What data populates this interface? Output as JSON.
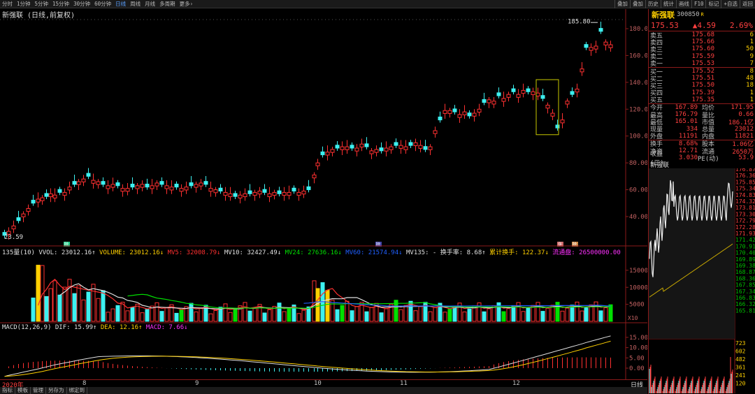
{
  "toolbar": {
    "timeframes": [
      "分时",
      "1分钟",
      "5分钟",
      "15分钟",
      "30分钟",
      "60分钟",
      "日线",
      "周线",
      "月线",
      "多周期",
      "更多›"
    ],
    "active_timeframe": "日线",
    "right_buttons": [
      "叠加",
      "叠加",
      "历史",
      "统计",
      "画线",
      "F10",
      "标记",
      "+自选",
      "返回"
    ]
  },
  "chart": {
    "title": "新强联 (日线,前复权)",
    "high_label": "185.80",
    "low_label": "23.59",
    "y_ticks": [
      "180.00",
      "160.00",
      "140.00",
      "120.00",
      "100.00",
      "80.00",
      "60.00",
      "40.00"
    ],
    "markers": [
      "除",
      "除",
      "涨",
      "除"
    ]
  },
  "volume": {
    "header_prefix": "135量(10) VVOL: 23012.16↑",
    "items": [
      {
        "text": "VOLUME: 23012.16↓",
        "color": "#ffd000"
      },
      {
        "text": "MV5: 32008.79↓",
        "color": "#ff3030"
      },
      {
        "text": "MV10: 32427.49↓",
        "color": "#e0e0e0"
      },
      {
        "text": "MV24: 27636.16↓",
        "color": "#00e000"
      },
      {
        "text": "MV60: 21574.94↓",
        "color": "#2060ff"
      },
      {
        "text": "MV135: -",
        "color": "#e0e0e0"
      },
      {
        "text": "换手率: 8.68↑",
        "color": "#e0e0e0"
      },
      {
        "text": "累计换手: 122.37↓",
        "color": "#ffd000"
      },
      {
        "text": "流通盘: 26500000.00",
        "color": "#ff30ff"
      }
    ],
    "y_ticks": [
      "15000",
      "10000",
      "5000"
    ],
    "unit": "X10"
  },
  "macd": {
    "items": [
      {
        "text": "MACD(12,26,9) DIF: 15.99↑",
        "color": "#e0e0e0"
      },
      {
        "text": "DEA: 12.16↑",
        "color": "#ffd000"
      },
      {
        "text": "MACD: 7.66↓",
        "color": "#ff30ff"
      }
    ],
    "y_ticks": [
      "15.00",
      "10.00",
      "5.00",
      "0.00"
    ]
  },
  "dates": {
    "year": "2020年",
    "months": [
      "8",
      "9",
      "10",
      "11",
      "12"
    ],
    "period_label": "日线"
  },
  "bottom_tabs": [
    "指标",
    "模板",
    "管理",
    "另存为",
    "绑定到"
  ],
  "quote": {
    "name": "新强联",
    "code": "300850",
    "mark": "R",
    "price": "175.53",
    "change": "▲4.59",
    "pct": "2.69%",
    "sells": [
      {
        "label": "卖五",
        "price": "175.68",
        "vol": "6"
      },
      {
        "label": "卖四",
        "price": "175.66",
        "vol": "1"
      },
      {
        "label": "卖三",
        "price": "175.60",
        "vol": "50"
      },
      {
        "label": "卖二",
        "price": "175.59",
        "vol": "9"
      },
      {
        "label": "卖一",
        "price": "175.53",
        "vol": "7"
      }
    ],
    "buys": [
      {
        "label": "买一",
        "price": "175.52",
        "vol": "8"
      },
      {
        "label": "买二",
        "price": "175.51",
        "vol": "48"
      },
      {
        "label": "买三",
        "price": "175.50",
        "vol": "18"
      },
      {
        "label": "买四",
        "price": "175.39",
        "vol": "1"
      },
      {
        "label": "买五",
        "price": "175.35",
        "vol": "1"
      }
    ],
    "stats1": [
      {
        "k1": "今开",
        "v1": "167.89",
        "k2": "均价",
        "v2": "171.95"
      },
      {
        "k1": "最高",
        "v1": "176.79",
        "k2": "量比",
        "v2": "0.66"
      },
      {
        "k1": "最低",
        "v1": "165.01",
        "k2": "市值",
        "v2": "186.1亿"
      },
      {
        "k1": "现量",
        "v1": "334",
        "k2": "总量",
        "v2": "23012"
      },
      {
        "k1": "外盘",
        "v1": "11191",
        "k2": "内盘",
        "v2": "11821"
      }
    ],
    "stats2": [
      {
        "k1": "换手",
        "v1": "8.68%",
        "k2": "股本",
        "v2": "1.06亿"
      },
      {
        "k1": "净资",
        "v1": "12.71",
        "k2": "流通",
        "v2": "2650万"
      },
      {
        "k1": "收益(三)",
        "v1": "3.030",
        "k2": "PE(动)",
        "v2": "53.9"
      }
    ]
  },
  "intraday": {
    "name": "新强联",
    "price_ticks": [
      "176.87",
      "176.36",
      "175.85",
      "175.34",
      "174.83",
      "174.32",
      "173.81",
      "173.30",
      "172.79",
      "172.28",
      "171.93",
      "171.42",
      "170.91",
      "170.40",
      "169.89",
      "169.38",
      "168.87",
      "168.36",
      "167.85",
      "167.34",
      "166.83",
      "166.32",
      "165.81"
    ],
    "vol_ticks": [
      "723",
      "602",
      "482",
      "361",
      "241",
      "120"
    ]
  },
  "colors": {
    "up": "#ff3030",
    "down": "#3df0f0",
    "axis_border": "#8b1a1a",
    "ma": "#ffd000"
  }
}
